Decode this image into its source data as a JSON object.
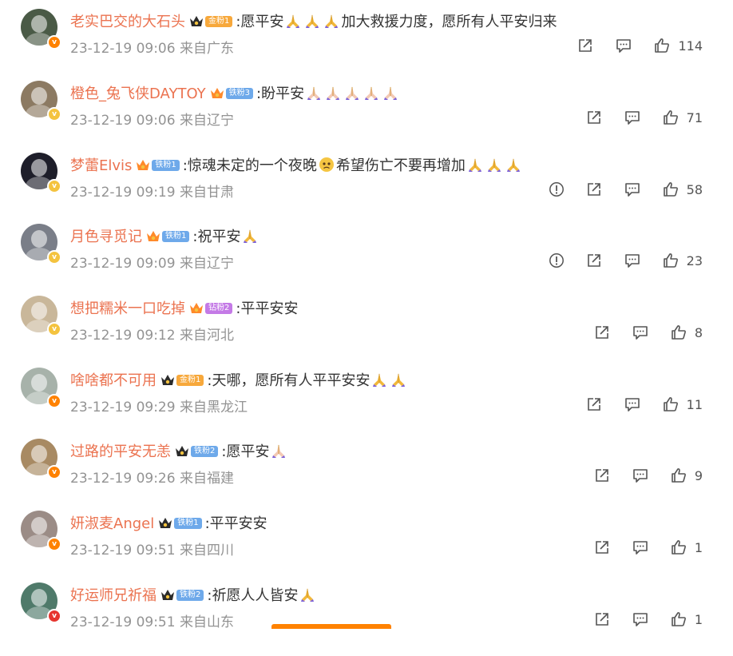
{
  "comments": [
    {
      "username": "老实巴交的大石头",
      "fan": "金粉1",
      "fan_color": "#f7a83b",
      "text": ":愿平安",
      "after_emoji": "加大救援力度，愿所有人平安归来",
      "emojis_before": 3,
      "emoji_color": "#f2b83a",
      "time": "23-12-19 09:06",
      "loc": "来自广东",
      "likes": "114",
      "report": false,
      "badge_color": "#ff8200",
      "avatar_color": "#4a5a46",
      "crown": "black"
    },
    {
      "username": "橙色_兔飞侠DAYTOY",
      "fan": "铁粉3",
      "fan_color": "#6ea9ea",
      "text": ":盼平安",
      "after_emoji": "",
      "emojis_before": 5,
      "emoji_color": "#f3c9b4",
      "time": "23-12-19 09:06",
      "loc": "来自辽宁",
      "likes": "71",
      "report": false,
      "badge_color": "#f4c33f",
      "avatar_color": "#8c7a62",
      "crown": "orange"
    },
    {
      "username": "梦蕾Elvis",
      "fan": "铁粉1",
      "fan_color": "#6ea9ea",
      "text": ":惊魂未定的一个夜晚",
      "after_emoji": "希望伤亡不要再增加",
      "emojis_before": 0,
      "emoji_color": "#f2b83a",
      "time": "23-12-19 09:19",
      "loc": "来自甘肃",
      "likes": "58",
      "report": true,
      "badge_color": "#f4c33f",
      "avatar_color": "#1e1e2a",
      "crown": "orange"
    },
    {
      "username": "月色寻觅记",
      "fan": "铁粉1",
      "fan_color": "#6ea9ea",
      "text": ":祝平安",
      "after_emoji": "",
      "emojis_before": 1,
      "emoji_color": "#f2b83a",
      "time": "23-12-19 09:09",
      "loc": "来自辽宁",
      "likes": "23",
      "report": true,
      "badge_color": "#f4c33f",
      "avatar_color": "#7a7e88",
      "crown": "orange"
    },
    {
      "username": "想把糯米一口吃掉",
      "fan": "钻粉2",
      "fan_color": "#c47ae6",
      "text": ":平平安安",
      "after_emoji": "",
      "emojis_before": 0,
      "emoji_color": "#f2b83a",
      "time": "23-12-19 09:12",
      "loc": "来自河北",
      "likes": "8",
      "report": false,
      "badge_color": "#f4c33f",
      "avatar_color": "#c9b79a",
      "crown": "orange"
    },
    {
      "username": "啥啥都不可用",
      "fan": "金粉1",
      "fan_color": "#f7a83b",
      "text": ":天哪，愿所有人平平安安",
      "after_emoji": "",
      "emojis_before": 2,
      "emoji_color": "#f2b83a",
      "time": "23-12-19 09:29",
      "loc": "来自黑龙江",
      "likes": "11",
      "report": false,
      "badge_color": "#ff8200",
      "avatar_color": "#a7b2aa",
      "crown": "black"
    },
    {
      "username": "过路的平安无恙",
      "fan": "铁粉2",
      "fan_color": "#6ea9ea",
      "text": ":愿平安",
      "after_emoji": "",
      "emojis_before": 1,
      "emoji_color": "#f3c9b4",
      "time": "23-12-19 09:26",
      "loc": "来自福建",
      "likes": "9",
      "report": false,
      "badge_color": "#ff8200",
      "avatar_color": "#a88a63",
      "crown": "black"
    },
    {
      "username": "妍淑麦Angel",
      "fan": "铁粉1",
      "fan_color": "#6ea9ea",
      "text": ":平平安安",
      "after_emoji": "",
      "emojis_before": 0,
      "emoji_color": "#f2b83a",
      "time": "23-12-19 09:51",
      "loc": "来自四川",
      "likes": "1",
      "report": false,
      "badge_color": "#ff8200",
      "avatar_color": "#9b8c86",
      "crown": "black"
    },
    {
      "username": "好运师兄祈福",
      "fan": "铁粉2",
      "fan_color": "#6ea9ea",
      "text": ":祈愿人人皆安",
      "after_emoji": "",
      "emojis_before": 1,
      "emoji_color": "#f2b83a",
      "time": "23-12-19 09:51",
      "loc": "来自山东",
      "likes": "1",
      "report": false,
      "badge_color": "#e6352f",
      "avatar_color": "#4f7a6a",
      "crown": "black"
    }
  ],
  "colors": {
    "username": "#eb7350",
    "meta": "#939393",
    "bar": "#ff8200"
  }
}
